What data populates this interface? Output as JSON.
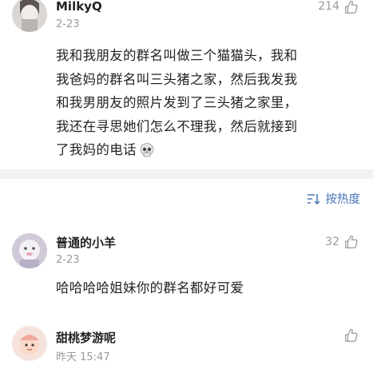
{
  "main_comment": {
    "username": "MilkyQ",
    "date": "2-23",
    "likes": "214",
    "lines": [
      "我和我朋友的群名叫做三个猫猫头，我和",
      "我爸妈的群名叫三头猪之家，然后我发我",
      "和我男朋友的照片发到了三头猪之家里，",
      "我还在寻思她们怎么不理我，然后就接到",
      "了我妈的电话"
    ],
    "emoji": "skull-emoji"
  },
  "sort": {
    "label": "按热度",
    "icon": "sort-icon",
    "color": "#4a76b8"
  },
  "replies": [
    {
      "username": "普通的小羊",
      "date": "2-23",
      "likes": "32",
      "text": "哈哈哈哈姐妹你的群名都好可爱"
    },
    {
      "username": "甜桃梦游呢",
      "date": "昨天 15:47",
      "likes": ""
    }
  ]
}
